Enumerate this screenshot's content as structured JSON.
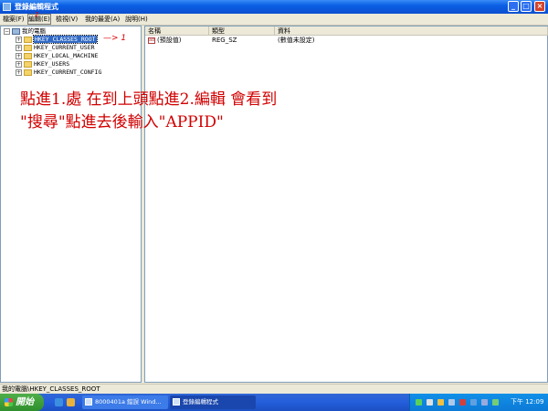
{
  "window": {
    "title": "登錄編輯程式"
  },
  "menu": [
    {
      "label": "檔案(F)"
    },
    {
      "label": "編輯(E)"
    },
    {
      "label": "檢視(V)"
    },
    {
      "label": "我的最愛(A)"
    },
    {
      "label": "說明(H)"
    }
  ],
  "tree": {
    "root": "我的電腦",
    "items": [
      {
        "label": "HKEY_CLASSES_ROOT"
      },
      {
        "label": "HKEY_CURRENT_USER"
      },
      {
        "label": "HKEY_LOCAL_MACHINE"
      },
      {
        "label": "HKEY_USERS"
      },
      {
        "label": "HKEY_CURRENT_CONFIG"
      }
    ]
  },
  "values": {
    "columns": [
      "名稱",
      "類型",
      "資料"
    ],
    "rows": [
      {
        "name": "(預設值)",
        "type": "REG_SZ",
        "data": "(數值未設定)"
      }
    ]
  },
  "annotation": {
    "line1": "點進1.處 在到上頭點進2.編輯 會看到",
    "line2": "\"搜尋\"點進去後輸入\"APPID\"",
    "marker1": "1",
    "marker2": "2"
  },
  "statusbar": {
    "path": "我的電腦\\HKEY_CLASSES_ROOT"
  },
  "taskbar": {
    "start": "開始",
    "tasks": [
      {
        "label": "8000401a 錯誤 Wind..."
      },
      {
        "label": "登錄編輯程式"
      }
    ],
    "clock": "下午 12:09"
  }
}
